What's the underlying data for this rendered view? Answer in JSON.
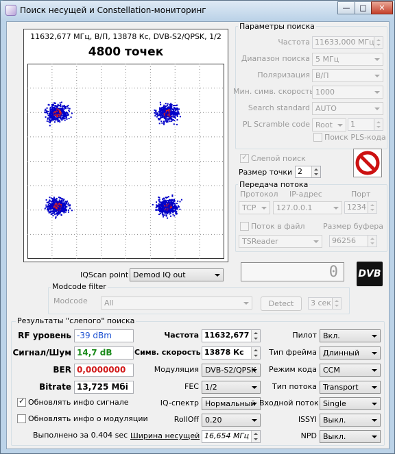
{
  "window": {
    "title": "Поиск несущей и Constellation-мониторинг",
    "controls": {
      "minimize": "—",
      "maximize": "□",
      "close": "✕"
    }
  },
  "plot": {
    "info": "11632,677 МГц, В/П, 13878 Кс, DVB-S2/QPSK, 1/2",
    "points_title": "4800 точек",
    "colors": {
      "dots": "#0000c8",
      "center": "#e0201a",
      "grid": "#8a8a8a"
    }
  },
  "params": {
    "group_title": "Параметры поиска",
    "freq_label": "Частота",
    "freq_value": "11633,000 МГц",
    "range_label": "Диапазон поиска",
    "range_value": "5 МГц",
    "pol_label": "Поляризация",
    "pol_value": "В/П",
    "minsr_label": "Мин. симв. скорость",
    "minsr_value": "1000",
    "std_label": "Search standard",
    "std_value": "AUTO",
    "pls_label": "PL Scramble code",
    "pls_mode": "Root",
    "pls_value": "1",
    "pls_search_label": "Поиск PLS-кода"
  },
  "blind": {
    "label": "Слепой поиск",
    "dotsize_label": "Размер точки",
    "dotsize_value": "2"
  },
  "stream": {
    "group_title": "Передача потока",
    "proto_label": "Протокол",
    "ip_label": "IP-адрес",
    "port_label": "Порт",
    "proto_value": "TCP",
    "ip_value": "127.0.0.1",
    "port_value": "1234",
    "tofile_label": "Поток в файл",
    "bufsize_label": "Размер буфера",
    "reader_value": "TSReader",
    "bufsize_value": "96256"
  },
  "counter": {
    "value": "0"
  },
  "dvb_logo": "DVB",
  "iqscan": {
    "label": "IQScan point",
    "value": "Demod IQ out"
  },
  "modcode": {
    "group_title": "Modcode filter",
    "label": "Modcode",
    "value": "All",
    "detect_label": "Detect",
    "interval_value": "3 сек"
  },
  "results": {
    "group_title": "Результаты \"слепого\" поиска",
    "rf_label": "RF уровень",
    "rf_value": "-39 dBm",
    "snr_label": "Сигнал/Шум",
    "snr_value": "14,7 dB",
    "ber_label": "BER",
    "ber_value": "0,0000000",
    "bitrate_label": "Bitrate",
    "bitrate_value": "13,725 Мбі",
    "upd_signal_label": "Обновлять инфо сигнале",
    "upd_mod_label": "Обновлять инфо о модуляции",
    "done_text": "Выполнено за 0.404 sec",
    "freq_label": "Частота",
    "freq_value": "11632,677 М",
    "sr_label": "Симв. скорость",
    "sr_value": "13878 Кс",
    "mod_label": "Модуляция",
    "mod_value": "DVB-S2/QPSK",
    "fec_label": "FEC",
    "fec_value": "1/2",
    "iq_label": "IQ-спектр",
    "iq_value": "Нормальный",
    "rolloff_label": "RollOff",
    "rolloff_value": "0.20",
    "bw_label": "Ширина несущей",
    "bw_value": "16,654 МГц",
    "pilot_label": "Пилот",
    "pilot_value": "Вкл.",
    "frame_label": "Тип фрейма",
    "frame_value": "Длинный",
    "codemode_label": "Режим кода",
    "codemode_value": "CCM",
    "streamtype_label": "Тип потока",
    "streamtype_value": "Transport",
    "input_label": "Входной поток",
    "input_value": "Single",
    "issyi_label": "ISSYI",
    "issyi_value": "Выкл.",
    "npd_label": "NPD",
    "npd_value": "Выкл.",
    "colors": {
      "rf": "#1a4fd1",
      "snr": "#1a8a1a",
      "ber": "#d11a1a"
    }
  }
}
